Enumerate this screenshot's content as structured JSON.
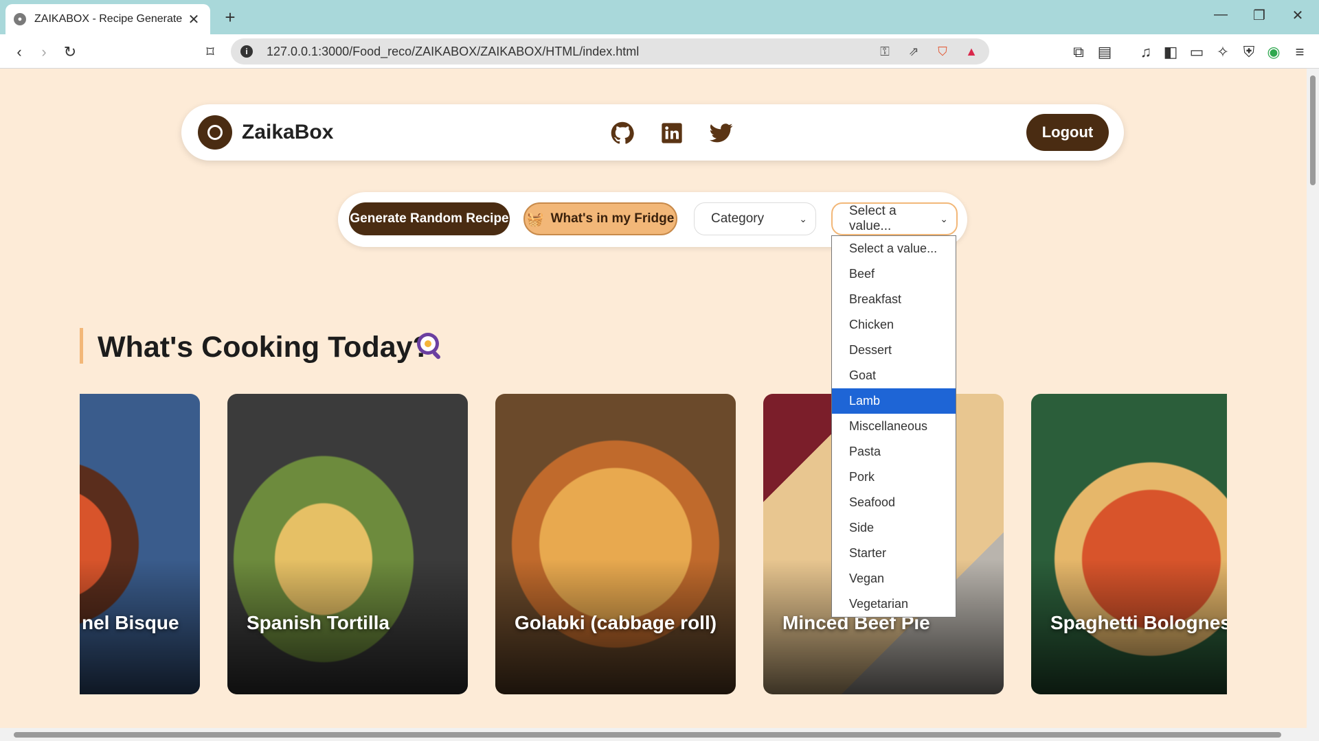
{
  "browser": {
    "tab_title": "ZAIKABOX - Recipe Generate",
    "url": "127.0.0.1:3000/Food_reco/ZAIKABOX/ZAIKABOX/HTML/index.html"
  },
  "header": {
    "brand": "ZaikaBox",
    "social": [
      "github-icon",
      "linkedin-icon",
      "twitter-icon"
    ],
    "logout_label": "Logout"
  },
  "controls": {
    "random_label": "Generate Random Recipe",
    "fridge_label": "What's in my Fridge",
    "category_select": "Category",
    "value_select": "Select a value..."
  },
  "dropdown": {
    "options": [
      "Select a value...",
      "Beef",
      "Breakfast",
      "Chicken",
      "Dessert",
      "Goat",
      "Lamb",
      "Miscellaneous",
      "Pasta",
      "Pork",
      "Seafood",
      "Side",
      "Starter",
      "Vegan",
      "Vegetarian"
    ],
    "highlighted": "Lamb"
  },
  "section": {
    "heading": "What's Cooking Today?"
  },
  "cards": [
    {
      "title": "nel Bisque"
    },
    {
      "title": "Spanish Tortilla"
    },
    {
      "title": "Golabki (cabbage roll)"
    },
    {
      "title": "Minced Beef Pie"
    },
    {
      "title": "Spaghetti Bolognese"
    }
  ],
  "colors": {
    "page_bg": "#fdebd7",
    "brand_dark": "#4a2c12",
    "accent": "#f2b778",
    "highlight": "#1e65d6"
  }
}
